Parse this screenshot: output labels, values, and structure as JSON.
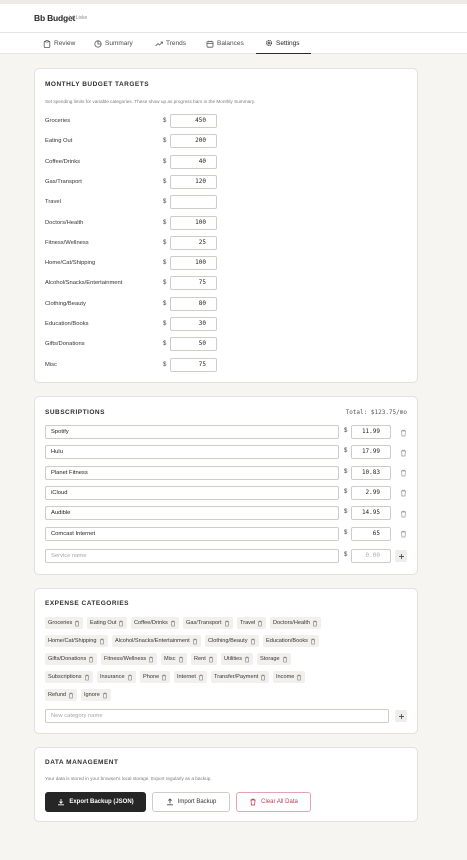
{
  "app": {
    "title": "Bb Budget",
    "byline": "by Liske"
  },
  "nav": {
    "tabs": [
      {
        "label": "Review",
        "icon": "clipboard-icon"
      },
      {
        "label": "Summary",
        "icon": "chart-icon"
      },
      {
        "label": "Trends",
        "icon": "trend-icon"
      },
      {
        "label": "Balances",
        "icon": "calendar-icon"
      },
      {
        "label": "Settings",
        "icon": "gear-icon",
        "active": true
      }
    ]
  },
  "budget": {
    "title": "MONTHLY BUDGET TARGETS",
    "description": "Set spending limits for variable categories. These show up as progress bars in the Monthly Summary.",
    "currency": "$",
    "rows": [
      {
        "label": "Groceries",
        "value": "450"
      },
      {
        "label": "Eating Out",
        "value": "200"
      },
      {
        "label": "Coffee/Drinks",
        "value": "40"
      },
      {
        "label": "Gas/Transport",
        "value": "120"
      },
      {
        "label": "Travel",
        "value": ""
      },
      {
        "label": "Doctors/Health",
        "value": "100"
      },
      {
        "label": "Fitness/Wellness",
        "value": "25"
      },
      {
        "label": "Home/Cat/Shipping",
        "value": "100"
      },
      {
        "label": "Alcohol/Snacks/Entertainment",
        "value": "75"
      },
      {
        "label": "Clothing/Beauty",
        "value": "80"
      },
      {
        "label": "Education/Books",
        "value": "30"
      },
      {
        "label": "Gifts/Donations",
        "value": "50"
      },
      {
        "label": "Misc",
        "value": "75"
      }
    ]
  },
  "subscriptions": {
    "title": "SUBSCRIPTIONS",
    "total": "Total: $123.75/mo",
    "currency": "$",
    "items": [
      {
        "name": "Spotify",
        "amount": "11.99"
      },
      {
        "name": "Hulu",
        "amount": "17.99"
      },
      {
        "name": "Planet Fitness",
        "amount": "10.83"
      },
      {
        "name": "iCloud",
        "amount": "2.99"
      },
      {
        "name": "Audible",
        "amount": "14.95"
      },
      {
        "name": "Comcast Internet",
        "amount": "65"
      }
    ],
    "new_name_placeholder": "Service name",
    "new_amount_placeholder": "0.00"
  },
  "categories": {
    "title": "EXPENSE CATEGORIES",
    "items": [
      "Groceries",
      "Eating Out",
      "Coffee/Drinks",
      "Gas/Transport",
      "Travel",
      "Doctors/Health",
      "Home/Cat/Shipping",
      "Alcohol/Snacks/Entertainment",
      "Clothing/Beauty",
      "Education/Books",
      "Gifts/Donations",
      "Fitness/Wellness",
      "Misc",
      "Rent",
      "Utilities",
      "Storage",
      "Subscriptions",
      "Insurance",
      "Phone",
      "Internet",
      "Transfer/Payment",
      "Income",
      "Refund",
      "Ignore"
    ],
    "new_placeholder": "New category name"
  },
  "data_mgmt": {
    "title": "DATA MANAGEMENT",
    "description": "Your data is stored in your browser's local storage. Export regularly as a backup.",
    "export_label": "Export Backup (JSON)",
    "import_label": "Import Backup",
    "clear_label": "Clear All Data"
  },
  "colors": {
    "danger": "#c53b56",
    "dark_button": "#262626",
    "page_bg": "#f6f5f2"
  }
}
